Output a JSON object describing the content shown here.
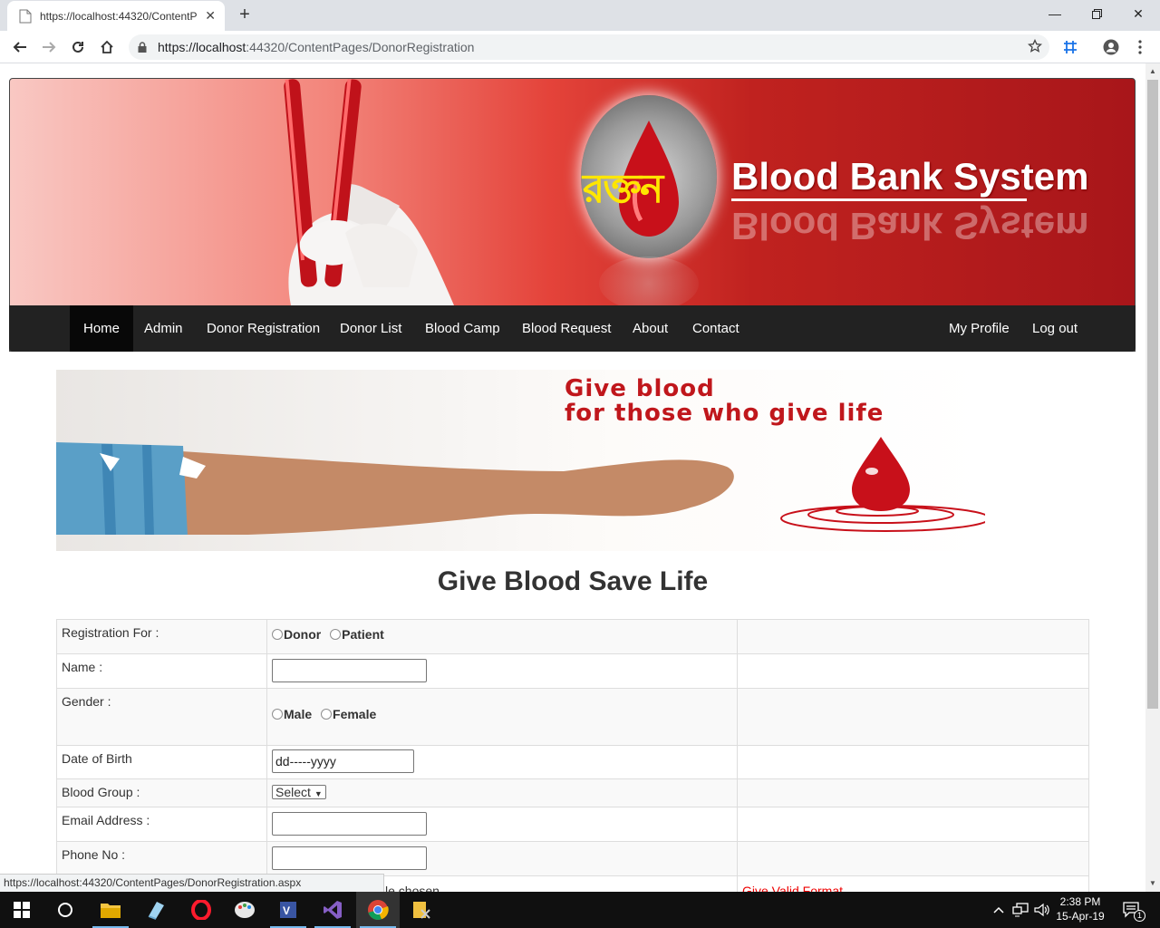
{
  "browser": {
    "tab_title": "https://localhost:44320/ContentP",
    "url_host": "https://localhost",
    "url_rest": ":44320/ContentPages/DonorRegistration"
  },
  "banner": {
    "script_logo": "রক্তন",
    "title": "Blood Bank System"
  },
  "nav": {
    "left": [
      "Home",
      "Admin",
      "Donor Registration",
      "Donor List",
      "Blood Camp",
      "Blood Request",
      "About",
      "Contact"
    ],
    "right": [
      "My Profile",
      "Log out"
    ],
    "active": "Home"
  },
  "hero": {
    "line1": "Give blood",
    "line2": "for those who give life"
  },
  "page": {
    "heading": "Give Blood Save Life"
  },
  "form": {
    "registration_for_label": "Registration For :",
    "registration_options": [
      "Donor",
      "Patient"
    ],
    "name_label": "Name :",
    "gender_label": "Gender :",
    "gender_options": [
      "Male",
      "Female"
    ],
    "dob_label": "Date of Birth",
    "dob_value": "dd-----yyyy",
    "blood_group_label": "Blood Group :",
    "blood_group_value": "Select",
    "email_label": "Email Address :",
    "phone_label": "Phone No :",
    "file_text": "le chosen",
    "validation_message": "Give Valid Format"
  },
  "status_url": "https://localhost:44320/ContentPages/DonorRegistration.aspx",
  "clock": {
    "time": "2:38 PM",
    "date": "15-Apr-19"
  },
  "notification_count": "1",
  "colors": {
    "brand_red": "#c0171c",
    "navbar": "#222222",
    "error": "#ee0000"
  }
}
